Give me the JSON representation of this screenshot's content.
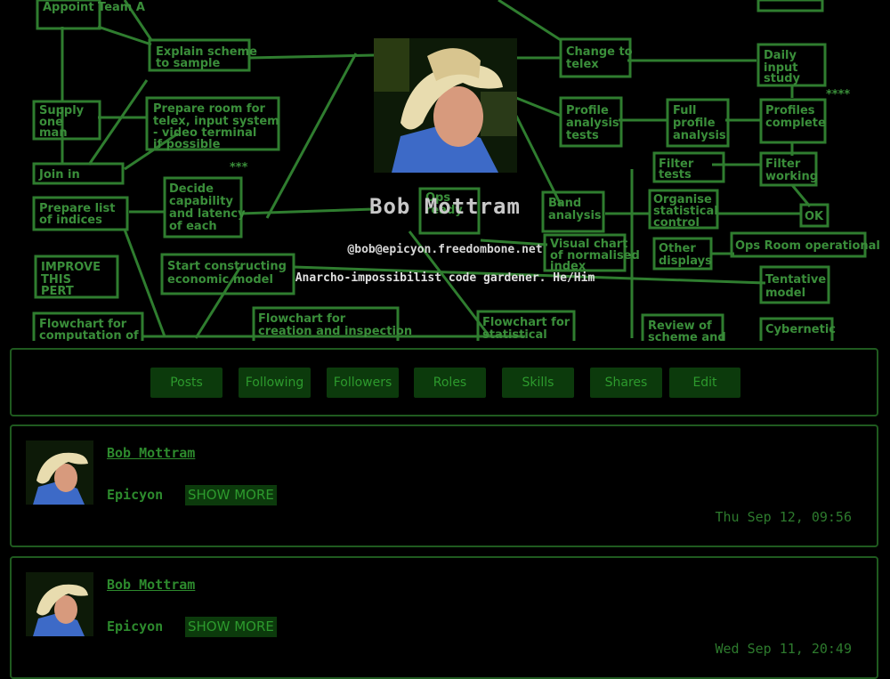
{
  "profile": {
    "name": "Bob Mottram",
    "handle": "@bob@epicyon.freedombone.net",
    "bio": "Anarcho-impossibilist code gardener. He/Him"
  },
  "banner_labels": [
    "Appoint Team A",
    "Explain scheme to sample",
    "Change to telex",
    "Daily input study",
    "Supply one man",
    "Prepare room for telex, input system - video terminal if possible",
    "Profile analysis tests",
    "Full profile analysis",
    "Profiles complete",
    "Join in",
    "Filter tests",
    "Filter working",
    "Prepare list of indices",
    "Decide capability and latency of each",
    "Ops ready",
    "Band analysis",
    "Organise statistical control",
    "OK",
    "IMPROVE THIS PERT",
    "Visual chart of normalised index",
    "Other displays",
    "Ops Room operational",
    "Start constructing economic model",
    "Tentative model",
    "Flowchart for computation of",
    "Flowchart for creation and inspection",
    "Flowchart for statistical",
    "Review of scheme and",
    "Cybernetic"
  ],
  "nav": {
    "items": [
      "Posts",
      "Following",
      "Followers",
      "Roles",
      "Skills",
      "Shares",
      "Edit"
    ]
  },
  "posts": [
    {
      "author": "Bob Mottram",
      "domain": "Epicyon",
      "show_more": "SHOW MORE",
      "time": "Thu Sep 12, 09:56"
    },
    {
      "author": "Bob Mottram",
      "domain": "Epicyon",
      "show_more": "SHOW MORE",
      "time": "Wed Sep 11, 20:49"
    }
  ],
  "colors": {
    "background": "#000000",
    "accent_green": "#2d9a2d",
    "button_bg": "#0c3a0c",
    "panel_border": "#1f5a1f"
  }
}
